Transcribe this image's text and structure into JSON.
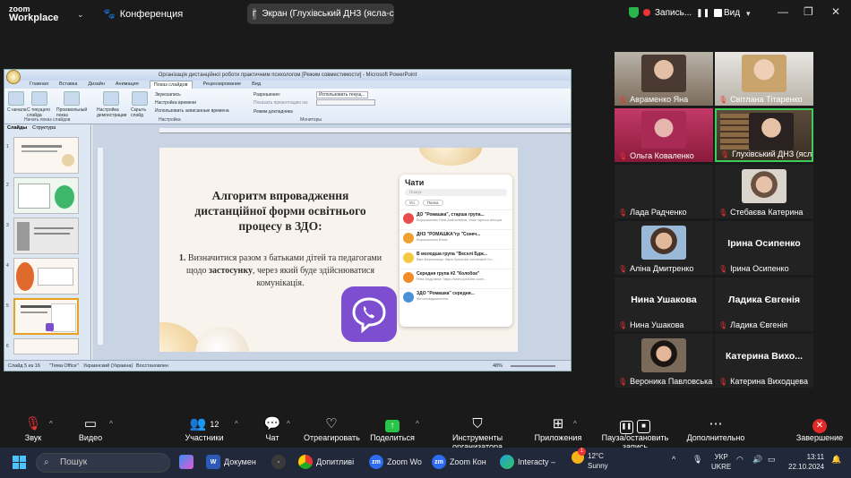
{
  "zoom": {
    "brand_top": "zoom",
    "brand_bottom": "Workplace",
    "conference_label": "Конференция",
    "share_label": "Экран (Глухівський ДНЗ (ясла-с...",
    "share_badge": "Г",
    "recording_label": "Запись...",
    "view_label": "Вид"
  },
  "powerpoint": {
    "window_title": "Організація дистанційної роботи практичним психологом [Режим совместимости] - Microsoft PowerPoint",
    "tabs": [
      "Главная",
      "Вставка",
      "Дизайн",
      "Анимация",
      "Показ слайдов",
      "Рецензирование",
      "Вид"
    ],
    "active_tab": "Показ слайдов",
    "ribbon": {
      "btn_start": "С начала",
      "btn_current": "С текущего слайда",
      "btn_custom": "Произвольный показ",
      "btn_setup": "Настройка демонстрации",
      "btn_hide": "Скрыть слайд",
      "opt_record": "Звукозапись",
      "opt_timing": "Настройка времени",
      "opt_use_timing": "Использовать записанные времена",
      "opt_resolution": "Разрешение:",
      "opt_resolution_val": "Использовать текущ...",
      "opt_show_on": "Показать презентацию на:",
      "opt_presenter": "Режим докладчика",
      "group_start": "Начать показ слайдов",
      "group_setup": "Настройка",
      "group_monitors": "Мониторы"
    },
    "left_tabs": [
      "Слайды",
      "Структура"
    ],
    "thumb_numbers": [
      "1",
      "2",
      "3",
      "4",
      "5",
      "6"
    ],
    "status": {
      "slide": "Слайд 5 из 16",
      "theme": "\"Тема Office\"",
      "lang": "Украинский (Украина)",
      "mode": "Восстановлен",
      "zoom": "48%"
    }
  },
  "slide": {
    "title": "Алгоритм впровадження дистанційної форми освітнього процесу в ЗДО:",
    "body_num": "1.",
    "body_pre": "Визначитися разом з батьками дітей та педагогами щодо ",
    "body_bold": "застосунку",
    "body_post": ", через який буде здійснюватися комунікація.",
    "chats_title": "Чати",
    "chats_search": "Пошук",
    "chats_filter_all": "Усі",
    "chats_filter_2": "Папка",
    "chats": [
      {
        "name": "ДО \"Ромашка\", старша група...",
        "msg": "Ворошилова Ніна Анатоліївна: Усім гарного вечора",
        "color": "#e94e4e"
      },
      {
        "name": "ДНЗ \"РОМАШКА\"гр \"Сонеч...",
        "msg": "Ворошилова Юлія: ",
        "color": "#f0a030"
      },
      {
        "name": "В молодша група \"Веселі Бдж...",
        "msg": "Віка Бережниця: https://youtube.com/watch?v=...",
        "color": "#f5c842"
      },
      {
        "name": "Середня група #2 \"Колобок\"",
        "msg": "Ніна Андріївна: https://www.youtube.com/...",
        "color": "#f28c28"
      },
      {
        "name": "ЗДО \"Ромашка\" середня...",
        "msg": "Фотоповідомлення",
        "color": "#4a90d9"
      }
    ]
  },
  "participants": [
    {
      "name": "Авраменко Яна",
      "big": ""
    },
    {
      "name": "Світлана Тітаренко",
      "big": ""
    },
    {
      "name": "Ольга Коваленко",
      "big": ""
    },
    {
      "name": "Глухівський ДНЗ (ясла-с...",
      "big": ""
    },
    {
      "name": "Лада Радченко",
      "big": ""
    },
    {
      "name": "Стебаєва Катерина",
      "big": ""
    },
    {
      "name": "Аліна Дмитренко",
      "big": ""
    },
    {
      "name": "Ірина Осипенко",
      "big": "Ірина Осипенко"
    },
    {
      "name": "Нина Ушакова",
      "big": "Нина Ушакова"
    },
    {
      "name": "Ладика Євгенія",
      "big": "Ладика Євгенія"
    },
    {
      "name": "Вероника Павловська",
      "big": ""
    },
    {
      "name": "Катерина Виходцева",
      "big": "Катерина  Вихо..."
    }
  ],
  "toolbar": {
    "audio": "Звук",
    "video": "Видео",
    "participants": "Участники",
    "participants_count": "12",
    "chat": "Чат",
    "react": "Отреагировать",
    "share": "Поделиться",
    "host_tools": "Инструменты организатора",
    "apps": "Приложения",
    "pause_rec": "Пауза/остановить запись",
    "more": "Дополнительно",
    "end": "Завершение"
  },
  "taskbar": {
    "search": "Пошук",
    "word": "Докумен",
    "chrome": "Допитливі",
    "zoom1": "Zoom Wo",
    "zoom2": "Zoom Кон",
    "edge": "Interacty –",
    "weather_temp": "12°C",
    "weather_desc": "Sunny",
    "weather_badge": "1",
    "lang1": "УКР",
    "lang2": "UKRE",
    "time": "13:11",
    "date": "22.10.2024"
  }
}
